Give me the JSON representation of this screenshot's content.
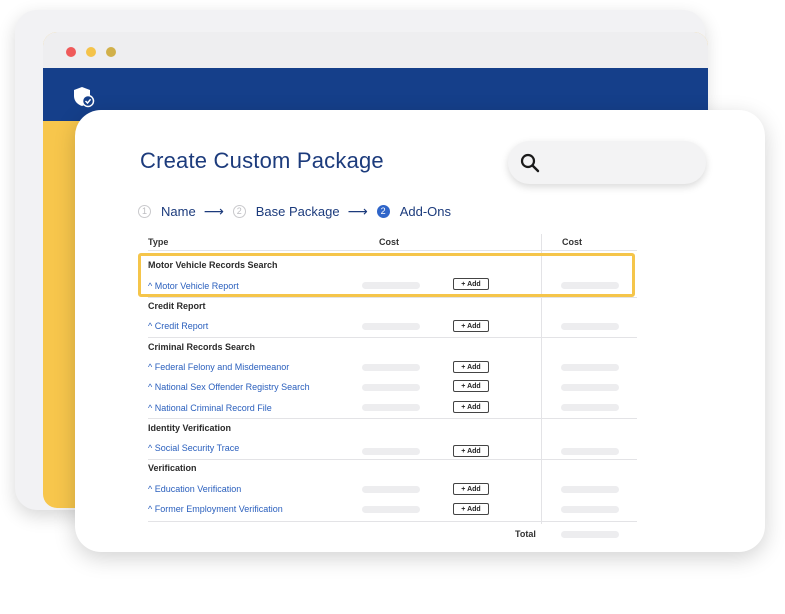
{
  "browser": {
    "colors": {
      "header": "#153f8a",
      "sidebar": "#f7c64c"
    },
    "logo_icon": "shield-check-icon"
  },
  "card": {
    "title": "Create Custom Package",
    "search": {
      "icon": "search-icon"
    },
    "steps": [
      {
        "number": "1",
        "label": "Name",
        "active": false
      },
      {
        "number": "2",
        "label": "Base Package",
        "active": false
      },
      {
        "number": "2",
        "label": "Add-Ons",
        "active": true
      }
    ],
    "table": {
      "headers": {
        "type": "Type",
        "cost": "Cost",
        "cost2": "Cost"
      },
      "add_label": "+ Add",
      "total_label": "Total",
      "highlighted_section": "Motor Vehicle Records Search",
      "categories": [
        {
          "name": "Motor Vehicle Records Search",
          "items": [
            "^ Motor Vehicle Report"
          ]
        },
        {
          "name": "Credit Report",
          "items": [
            "^ Credit Report"
          ]
        },
        {
          "name": "Criminal Records Search",
          "items": [
            "^ Federal Felony and Misdemeanor",
            "^ National Sex Offender Registry Search",
            "^ National Criminal Record File"
          ]
        },
        {
          "name": "Identity Verification",
          "items": [
            "^ Social Security Trace"
          ]
        },
        {
          "name": "Verification",
          "items": [
            "^ Education Verification",
            "^ Former Employment Verification"
          ]
        }
      ]
    }
  }
}
